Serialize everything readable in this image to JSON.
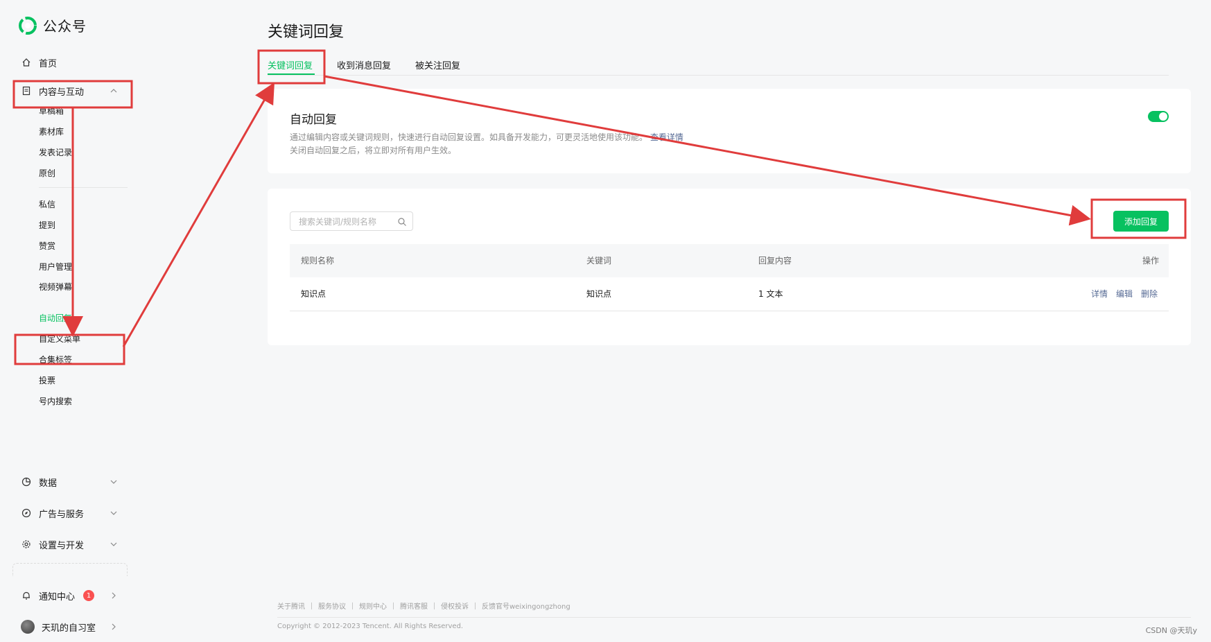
{
  "brand": {
    "name": "公众号"
  },
  "sidebar": {
    "home": {
      "label": "首页",
      "icon": "home-icon"
    },
    "content_interaction": {
      "label": "内容与互动",
      "icon": "document-icon"
    },
    "sub_items_1": [
      "草稿箱",
      "素材库",
      "发表记录",
      "原创"
    ],
    "sub_items_2": [
      "私信",
      "提到",
      "赞赏",
      "用户管理",
      "视频弹幕"
    ],
    "auto_reply": "自动回复",
    "sub_items_3": [
      "自定义菜单",
      "合集标签",
      "投票",
      "号内搜索"
    ],
    "data": {
      "label": "数据",
      "icon": "pie-chart-icon"
    },
    "ads": {
      "label": "广告与服务",
      "icon": "compass-icon"
    },
    "settings": {
      "label": "设置与开发",
      "icon": "gear-icon"
    },
    "notifications": {
      "label": "通知中心",
      "icon": "bell-icon",
      "count": "1"
    },
    "account": {
      "name": "天玑的自习室"
    }
  },
  "main": {
    "title": "关键词回复",
    "tabs": [
      "关键词回复",
      "收到消息回复",
      "被关注回复"
    ],
    "auto_reply_card": {
      "title": "自动回复",
      "desc_line1": "通过编辑内容或关键词规则，快速进行自动回复设置。如具备开发能力，可更灵活地使用该功能。",
      "desc_link": "查看详情",
      "desc_line2": "关闭自动回复之后，将立即对所有用户生效。",
      "enabled": true
    },
    "search": {
      "placeholder": "搜索关键词/规则名称"
    },
    "add_button": "添加回复",
    "table": {
      "headers": [
        "规则名称",
        "关键词",
        "回复内容",
        "操作"
      ],
      "rows": [
        {
          "rule": "知识点",
          "keyword": "知识点",
          "content": "1 文本",
          "ops": [
            "详情",
            "编辑",
            "删除"
          ]
        }
      ]
    }
  },
  "footer": {
    "links": [
      "关于腾讯",
      "服务协议",
      "规则中心",
      "腾讯客服",
      "侵权投诉",
      "反馈官号weixingongzhong"
    ],
    "copyright": "Copyright © 2012-2023 Tencent. All Rights Reserved."
  },
  "watermark": "CSDN @天玑y",
  "colors": {
    "accent": "#07c160",
    "link": "#576b95",
    "annotation": "#e03c3c"
  }
}
